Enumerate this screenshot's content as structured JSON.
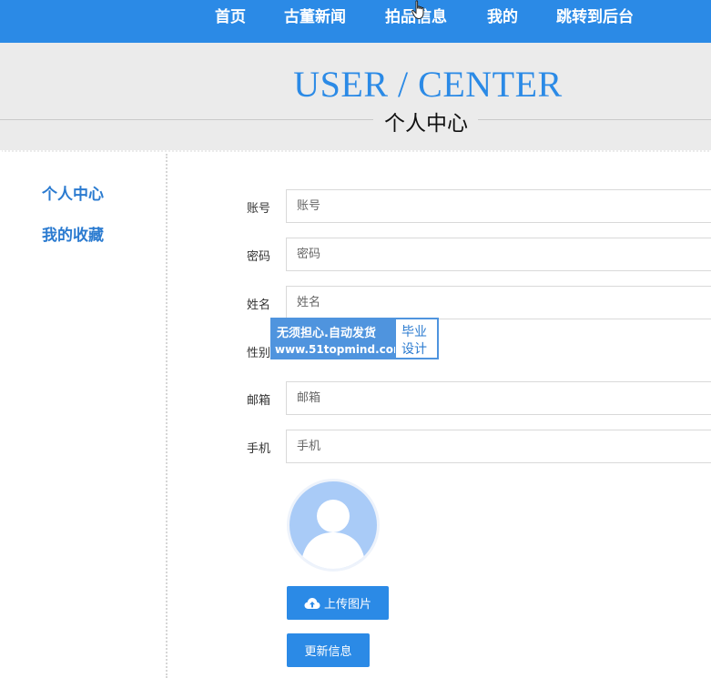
{
  "nav": {
    "items": [
      {
        "label": "首页"
      },
      {
        "label": "古董新闻"
      },
      {
        "label": "拍品信息"
      },
      {
        "label": "我的"
      },
      {
        "label": "跳转到后台"
      }
    ]
  },
  "banner": {
    "title": "USER / CENTER",
    "subtitle": "个人中心"
  },
  "sidebar": {
    "items": [
      {
        "label": "个人中心"
      },
      {
        "label": "我的收藏"
      }
    ]
  },
  "form": {
    "fields": [
      {
        "label": "账号",
        "placeholder": "账号"
      },
      {
        "label": "密码",
        "placeholder": "密码"
      },
      {
        "label": "姓名",
        "placeholder": "姓名"
      },
      {
        "label": "性别",
        "placeholder": ""
      },
      {
        "label": "邮箱",
        "placeholder": "邮箱"
      },
      {
        "label": "手机",
        "placeholder": "手机"
      }
    ],
    "upload_label": "上传图片",
    "update_label": "更新信息"
  },
  "watermark": {
    "line1": "无须担心.自动发货",
    "line2": "www.51topmind.com",
    "right1": "毕业",
    "right2": "设计"
  },
  "colors": {
    "accent": "#2b8ae6",
    "banner_bg": "#ebebeb",
    "sidebar_link": "#2b7bd0"
  }
}
